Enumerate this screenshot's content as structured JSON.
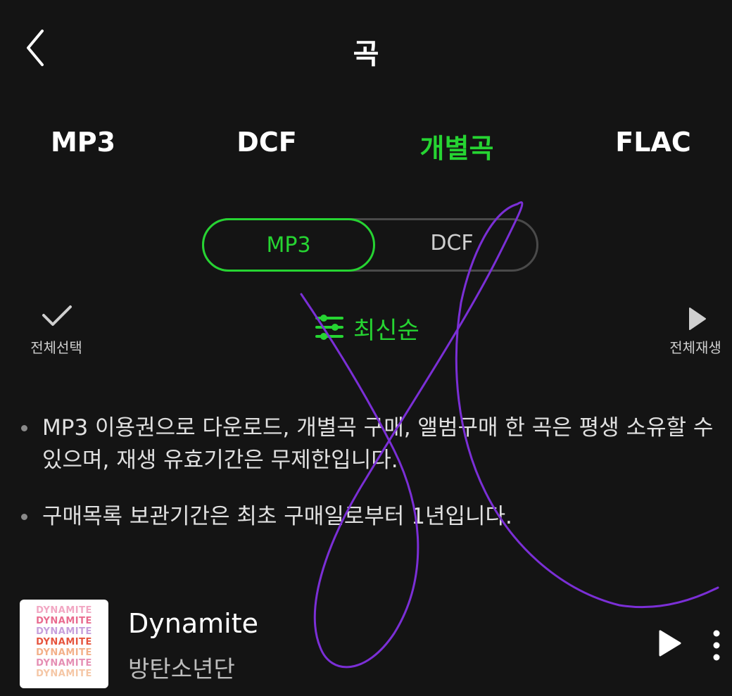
{
  "header": {
    "title": "곡"
  },
  "tabs": [
    {
      "label": "MP3"
    },
    {
      "label": "DCF"
    },
    {
      "label": "개별곡",
      "active": true
    },
    {
      "label": "FLAC"
    }
  ],
  "segment": {
    "options": [
      "MP3",
      "DCF"
    ],
    "selected": "MP3"
  },
  "actions": {
    "select_all": "전체선택",
    "sort": "최신순",
    "play_all": "전체재생"
  },
  "notices": [
    "MP3 이용권으로 다운로드, 개별곡 구매, 앨범구매 한 곡은 평생 소유할 수 있으며, 재생 유효기간은 무제한입니다.",
    "구매목록 보관기간은 최초 구매일로부터 1년입니다."
  ],
  "track": {
    "title": "Dynamite",
    "artist": "방탄소년단",
    "album_art_text": "DYNAMITE"
  },
  "colors": {
    "background": "#141414",
    "accent": "#26d432",
    "scribble": "#7b2fd6"
  },
  "icons": [
    "back-chevron-icon",
    "check-icon",
    "sort-sliders-icon",
    "play-icon",
    "more-vertical-icon"
  ]
}
